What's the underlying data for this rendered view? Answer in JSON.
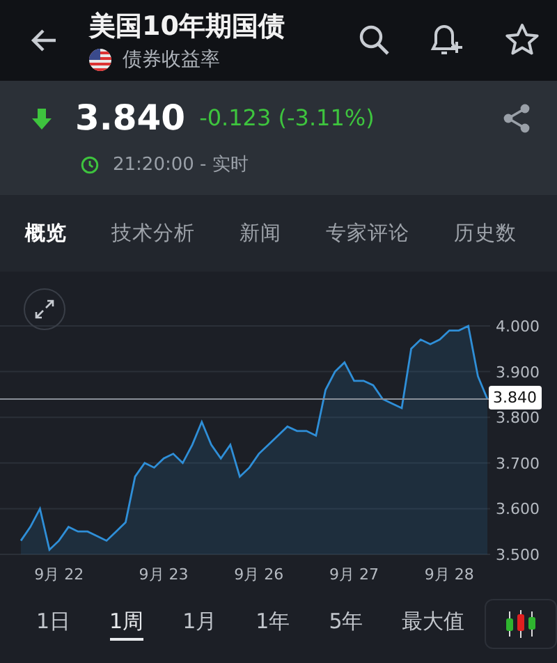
{
  "header": {
    "title": "美国10年期国债",
    "subtitle": "债券收益率"
  },
  "quote": {
    "kind": "down",
    "price": "3.840",
    "change": "-0.123 (-3.11%)",
    "time": "21:20:00 - 实时"
  },
  "tabs": [
    {
      "label": "概览",
      "selected": true
    },
    {
      "label": "技术分析",
      "selected": false
    },
    {
      "label": "新闻",
      "selected": false
    },
    {
      "label": "专家评论",
      "selected": false
    },
    {
      "label": "历史数",
      "selected": false
    }
  ],
  "chart": {
    "chart_data": {
      "type": "area",
      "grid": true,
      "ylim": [
        3.5,
        4.0
      ],
      "ref_lines": [
        {
          "axis": "y",
          "value": 3.84,
          "label": "3.840",
          "color": "#8a9099"
        }
      ],
      "categories": [
        null,
        null,
        null,
        null,
        "9月 22",
        null,
        null,
        null,
        null,
        null,
        null,
        null,
        null,
        null,
        null,
        "9月 23",
        null,
        null,
        null,
        null,
        null,
        null,
        null,
        null,
        null,
        "9月 26",
        null,
        null,
        null,
        null,
        null,
        null,
        null,
        null,
        null,
        "9月 27",
        null,
        null,
        null,
        null,
        null,
        null,
        null,
        null,
        null,
        "9月 28",
        null,
        null,
        null,
        null
      ],
      "series": [
        {
          "color": "#2f8fd8",
          "values": [
            3.53,
            3.56,
            3.6,
            3.51,
            3.53,
            3.56,
            3.55,
            3.55,
            3.54,
            3.53,
            3.55,
            3.57,
            3.67,
            3.7,
            3.69,
            3.71,
            3.72,
            3.7,
            3.74,
            3.79,
            3.74,
            3.71,
            3.74,
            3.67,
            3.69,
            3.72,
            3.74,
            3.76,
            3.78,
            3.77,
            3.77,
            3.76,
            3.86,
            3.9,
            3.92,
            3.88,
            3.88,
            3.87,
            3.84,
            3.83,
            3.82,
            3.95,
            3.97,
            3.96,
            3.97,
            3.99,
            3.99,
            4.0,
            3.89,
            3.84
          ]
        }
      ],
      "yticks": [
        {
          "value": 3.5,
          "label": "3.500"
        },
        {
          "value": 3.6,
          "label": "3.600"
        },
        {
          "value": 3.7,
          "label": "3.700"
        },
        {
          "value": 3.8,
          "label": "3.800"
        },
        {
          "value": 3.9,
          "label": "3.900"
        },
        {
          "value": 4.0,
          "label": "4.000"
        }
      ]
    }
  },
  "ranges": [
    {
      "label": "1日",
      "selected": false
    },
    {
      "label": "1周",
      "selected": true
    },
    {
      "label": "1月",
      "selected": false
    },
    {
      "label": "1年",
      "selected": false
    },
    {
      "label": "5年",
      "selected": false
    },
    {
      "label": "最大值",
      "selected": false
    }
  ]
}
